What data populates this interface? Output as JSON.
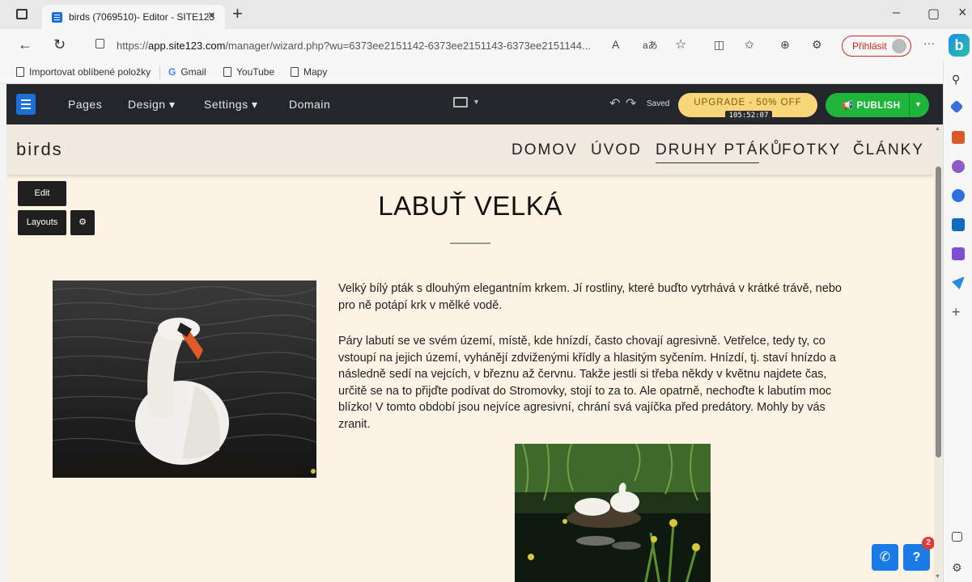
{
  "browser": {
    "tab_title": "birds (7069510)- Editor - SITE123",
    "tab_close": "×",
    "new_tab": "+",
    "url_prefix": "https://",
    "url_host": "app.site123.com",
    "url_path": "/manager/wizard.php?wu=6373ee2151142-6373ee2151143-6373ee2151144...",
    "read_aloud": "A",
    "translate": "aあ",
    "signin_label": "Přihlásit",
    "bing_label": "b",
    "more": "···",
    "win_min": "–",
    "win_restore": "▢",
    "win_close": "×"
  },
  "favorites": [
    {
      "label": "Importovat oblíbené položky",
      "icon": "import-icon"
    },
    {
      "label": "Gmail",
      "icon": "google-icon"
    },
    {
      "label": "YouTube",
      "icon": "page-icon"
    },
    {
      "label": "Mapy",
      "icon": "page-icon"
    }
  ],
  "editor": {
    "menu": [
      "Pages",
      "Design ▾",
      "Settings ▾",
      "Domain"
    ],
    "saved": "Saved",
    "upgrade_label": "UPGRADE - 50% OFF",
    "timer": "105:52:07",
    "publish_label": "PUBLISH",
    "edit_label": "Edit",
    "layouts_label": "Layouts",
    "gear_symbol": "⚙"
  },
  "site": {
    "logo": "birds",
    "nav": [
      {
        "label": "DOMOV",
        "active": false
      },
      {
        "label": "ÚVOD",
        "active": false
      },
      {
        "label": "DRUHY PTÁKŮ",
        "active": true
      },
      {
        "label": "FOTKY",
        "active": false
      },
      {
        "label": "ČLÁNKY",
        "active": false
      }
    ],
    "heading": "LABUŤ VELKÁ",
    "paragraph1_lines": [
      "Velký bílý pták s dlouhým elegantním krkem. Jí rostliny, které buďto vytrhává v krátké trávě, nebo",
      "pro ně potápí krk v mělké vodě."
    ],
    "paragraph2_lines": [
      "Páry labutí se ve svém území, místě, kde hnízdí, často chovají agresivně. Vetřelce, tedy ty, co",
      "vstoupí na jejich území, vyhánějí zdviženými křídly a hlasitým syčením. Hnízdí, tj. staví hnízdo a",
      "následně sedí na vejcích, v březnu až červnu. Takže jestli si třeba někdy v květnu najdete čas,",
      "určitě se na to přijďte podívat do Stromovky, stojí to za to. Ale opatrně, nechoďte k labutím moc",
      "blízko! V tomto období jsou nejvíce agresivní, chrání svá vajíčka před predátory. Mohly by vás",
      "zranit."
    ],
    "help_badge": "2",
    "help_label": "?"
  },
  "colors": {
    "editor_bar": "#23272c",
    "upgrade": "#f8d77a",
    "publish": "#1eb53a",
    "site_bg": "#fcf3e4",
    "header_bg": "#efe9e0",
    "accent_blue": "#1b7be6"
  }
}
